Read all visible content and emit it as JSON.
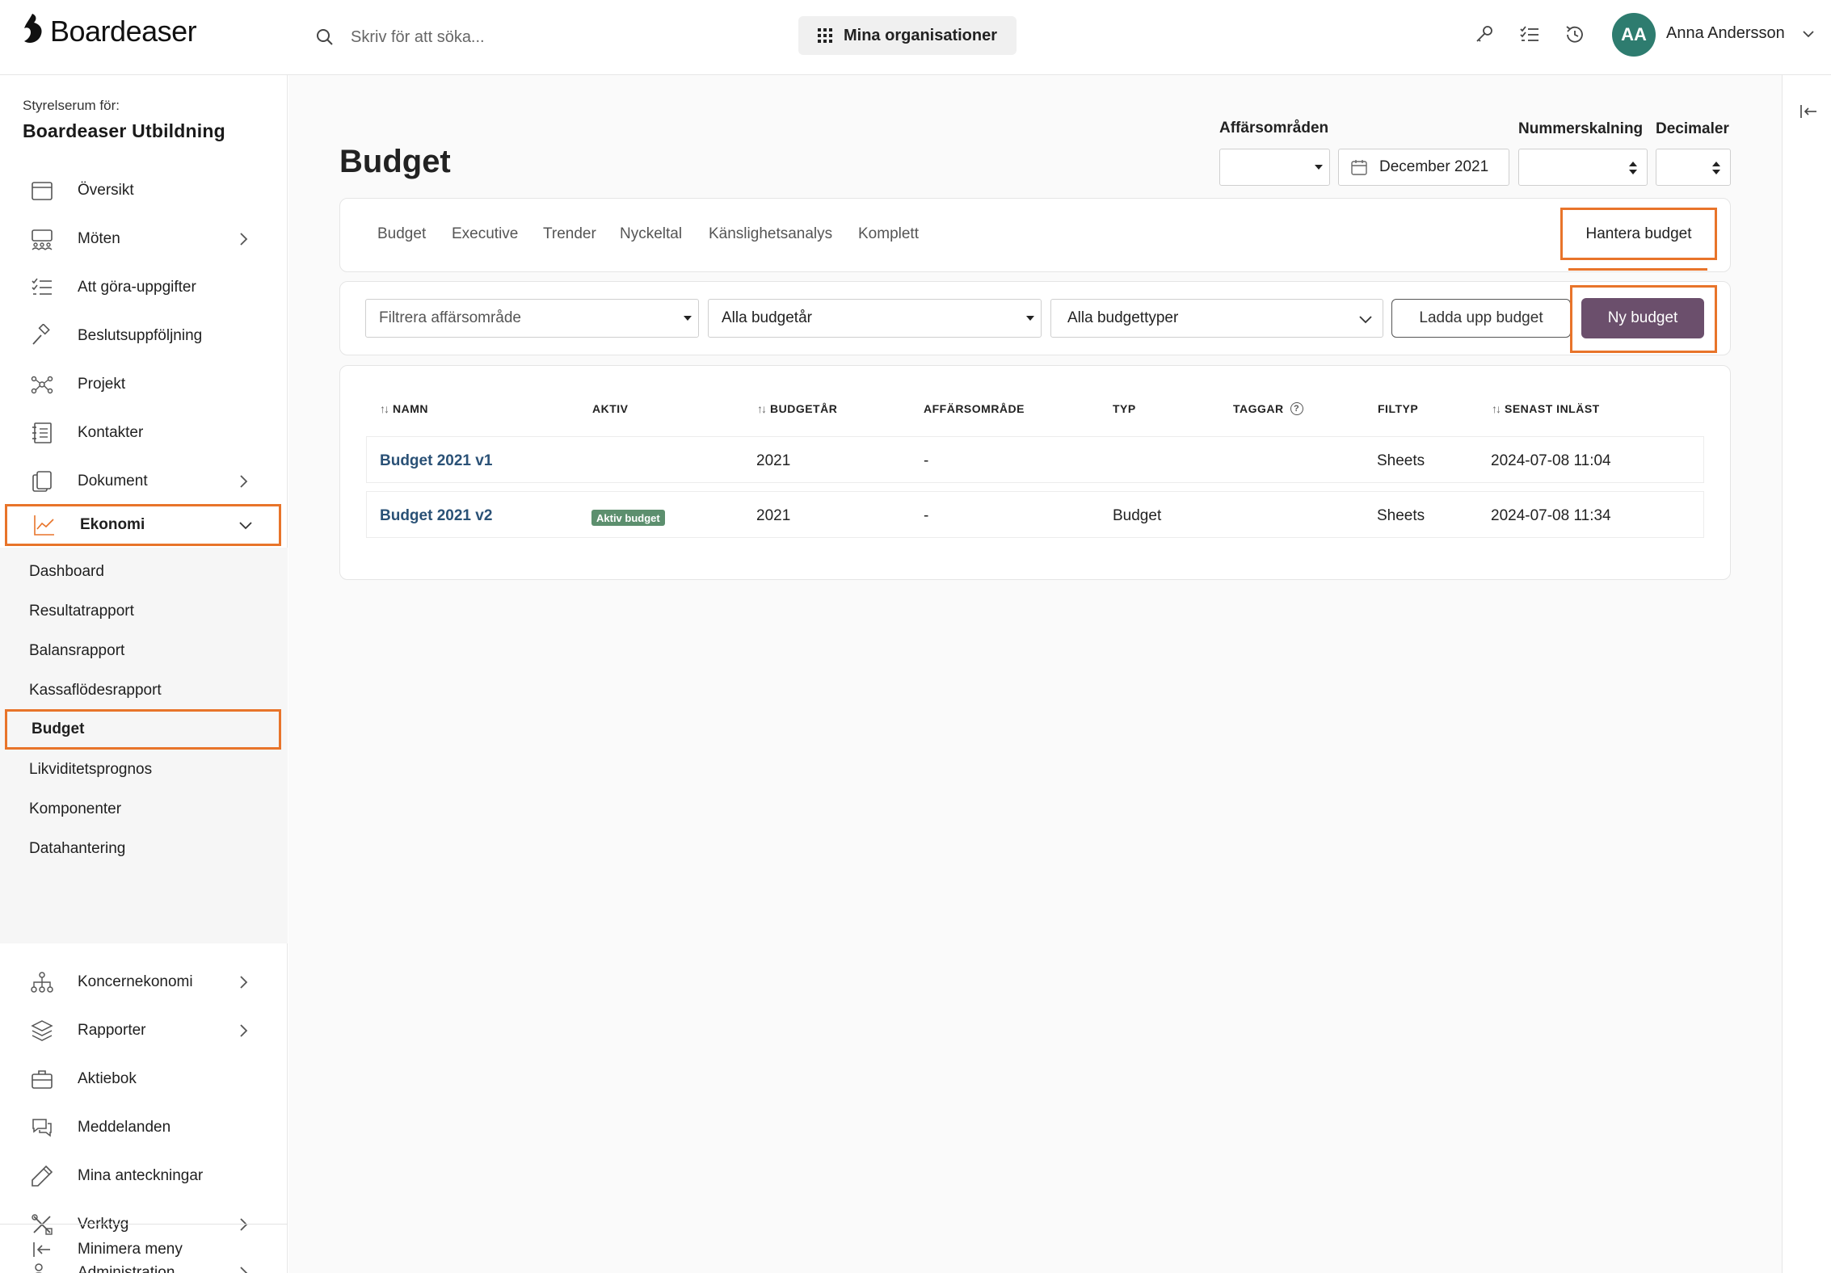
{
  "header": {
    "logo_text": "Boardeaser",
    "search_placeholder": "Skriv för att söka...",
    "orgs_button": "Mina organisationer",
    "user": {
      "initials": "AA",
      "name": "Anna Andersson",
      "avatar_color": "#2e7c6f"
    },
    "icons": [
      "key-icon",
      "checklist-icon",
      "history-icon"
    ]
  },
  "sidebar": {
    "caption": "Styrelserum för:",
    "org_name": "Boardeaser Utbildning",
    "items": [
      {
        "label": "Översikt",
        "icon": "calendar-icon"
      },
      {
        "label": "Möten",
        "icon": "meeting-icon",
        "chevron": true
      },
      {
        "label": "Att göra-uppgifter",
        "icon": "checklist-icon"
      },
      {
        "label": "Beslutsuppföljning",
        "icon": "gavel-icon"
      },
      {
        "label": "Projekt",
        "icon": "network-icon"
      },
      {
        "label": "Kontakter",
        "icon": "contacts-icon"
      },
      {
        "label": "Dokument",
        "icon": "documents-icon",
        "chevron": true
      },
      {
        "label": "Ekonomi",
        "icon": "chart-icon",
        "chevron": "down",
        "active": true
      }
    ],
    "economy_sub": [
      "Dashboard",
      "Resultatrapport",
      "Balansrapport",
      "Kassaflödesrapport",
      "Budget",
      "Likviditetsprognos",
      "Komponenter",
      "Datahantering"
    ],
    "economy_sub_active": "Budget",
    "items_lower": [
      {
        "label": "Koncernekonomi",
        "icon": "hierarchy-icon",
        "chevron": true
      },
      {
        "label": "Rapporter",
        "icon": "layers-icon",
        "chevron": true
      },
      {
        "label": "Aktiebok",
        "icon": "briefcase-icon"
      },
      {
        "label": "Meddelanden",
        "icon": "chat-icon"
      },
      {
        "label": "Mina anteckningar",
        "icon": "pencil-icon"
      },
      {
        "label": "Verktyg",
        "icon": "tools-icon",
        "chevron": true
      },
      {
        "label": "Administration",
        "icon": "admin-icon",
        "chevron": true
      }
    ],
    "minimize": "Minimera meny"
  },
  "page": {
    "title": "Budget",
    "controls": {
      "business_areas_label": "Affärsområden",
      "business_areas_value": "",
      "period": "December 2021",
      "number_scaling_label": "Nummerskalning",
      "number_scaling_value": "",
      "decimals_label": "Decimaler",
      "decimals_value": ""
    },
    "tabs": [
      "Budget",
      "Executive",
      "Trender",
      "Nyckeltal",
      "Känslighetsanalys",
      "Komplett"
    ],
    "manage_tab": "Hantera budget",
    "filters": {
      "business_area_placeholder": "Filtrera affärsområde",
      "budget_year": "Alla budgetår",
      "budget_type": "Alla budgettyper"
    },
    "upload_button": "Ladda upp budget",
    "new_button": "Ny budget",
    "table": {
      "columns": [
        "NAMN",
        "AKTIV",
        "BUDGETÅR",
        "AFFÄRSOMRÅDE",
        "TYP",
        "TAGGAR",
        "FILTYP",
        "SENAST INLÄST"
      ],
      "rows": [
        {
          "name": "Budget 2021 v1",
          "active": "",
          "year": "2021",
          "area": "-",
          "type": "",
          "tags": "",
          "filetype": "Sheets",
          "loaded": "2024-07-08 11:04"
        },
        {
          "name": "Budget 2021 v2",
          "active": "Aktiv budget",
          "year": "2021",
          "area": "-",
          "type": "Budget",
          "tags": "",
          "filetype": "Sheets",
          "loaded": "2024-07-08 11:34"
        }
      ]
    }
  },
  "colors": {
    "highlight": "#e8742a",
    "primary": "#6b4f6c",
    "link": "#2a5176",
    "badge": "#5c8f6e"
  }
}
